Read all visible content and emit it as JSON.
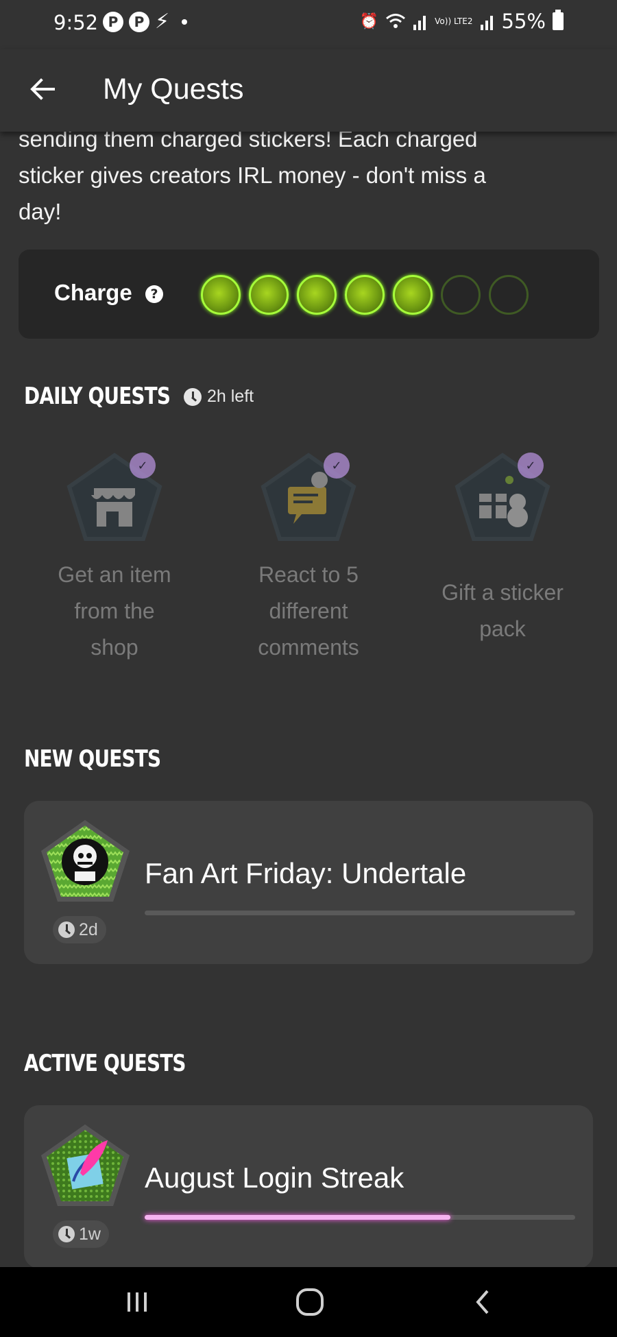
{
  "status_bar": {
    "time": "9:52",
    "left_icons": [
      "pinterest-icon",
      "pinterest-icon",
      "bolt-icon",
      "dot"
    ],
    "lte_label": "Vo)) LTE2",
    "battery": "55%"
  },
  "app_bar": {
    "title": "My Quests",
    "back_icon": "arrow-left-icon"
  },
  "intro": {
    "line1": "sending them charged stickers! Each charged",
    "line2": "sticker gives creators IRL money - don't miss a",
    "line3": "day!"
  },
  "charge": {
    "label": "Charge",
    "help_icon": "?",
    "filled": 5,
    "total": 7,
    "accent": "#a6ff3a"
  },
  "daily_quests": {
    "heading": "DAILY QUESTS",
    "time_left": "2h left",
    "items": [
      {
        "line1": "Get an item",
        "line2": "from the",
        "line3": "shop",
        "icon": "shop-icon"
      },
      {
        "line1": "React to 5",
        "line2": "different",
        "line3": "comments",
        "icon": "comment-icon"
      },
      {
        "line1": "Gift a sticker",
        "line2": "pack",
        "icon": "gift-icon"
      }
    ]
  },
  "new_quests": {
    "heading": "NEW QUESTS",
    "items": [
      {
        "title": "Fan Art Friday: Undertale",
        "time": "2d",
        "progress": 0,
        "icon": "skeleton-icon"
      }
    ]
  },
  "active_quests": {
    "heading": "ACTIVE QUESTS",
    "items": [
      {
        "title": "August Login Streak",
        "time": "1w",
        "progress": 0.71,
        "icon": "feather-icon",
        "color": "#f5b3f0"
      }
    ]
  },
  "nav_bar": {
    "buttons": [
      "recents-icon",
      "home-icon",
      "back-icon"
    ]
  }
}
